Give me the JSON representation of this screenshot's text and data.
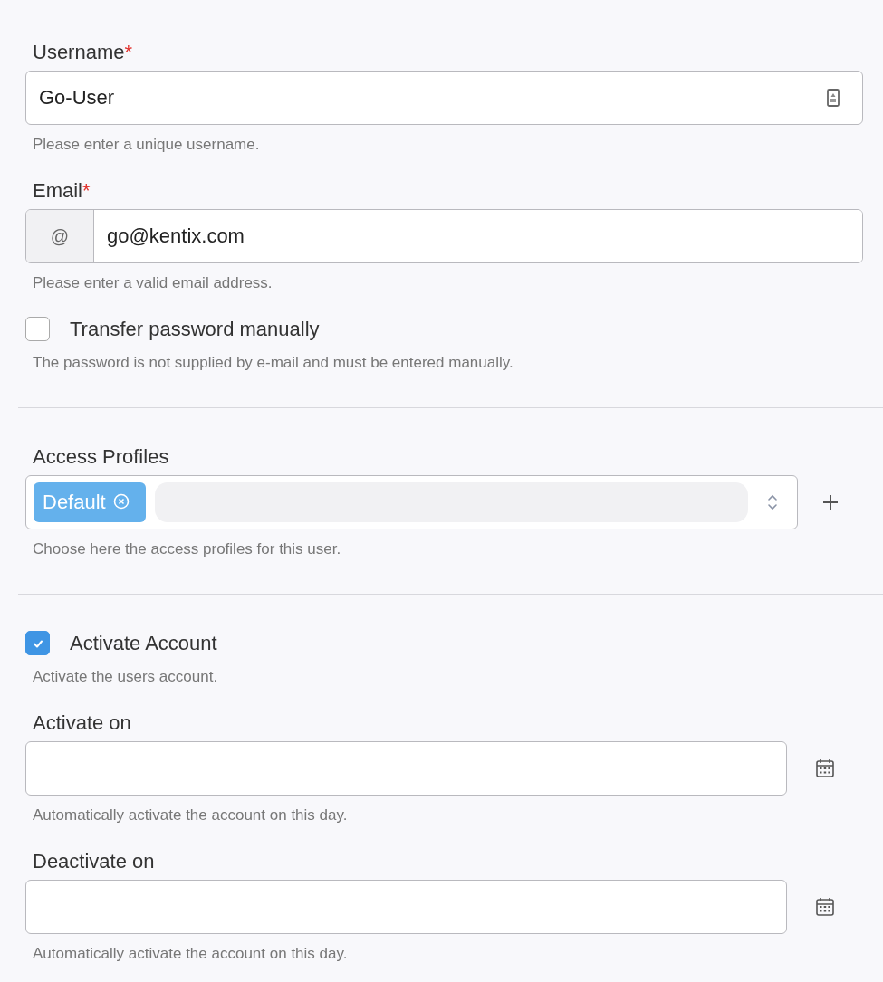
{
  "sections": [
    {
      "items": [
        {
          "kind": "text",
          "label": "Username",
          "required_mark": "*",
          "value": "Go-User",
          "hint": "Please enter a unique username."
        },
        {
          "kind": "prefixed",
          "label": "Email",
          "required_mark": "*",
          "prefix": "@",
          "value": "go@kentix.com",
          "hint": "Please enter a valid email address."
        },
        {
          "kind": "checkbox",
          "label": "Transfer password manually",
          "checked": false,
          "hint": "The password is not supplied by e-mail and must be entered manually."
        }
      ]
    },
    {
      "items": [
        {
          "kind": "tags",
          "label": "Access Profiles",
          "tags": [
            {
              "label": "Default"
            }
          ],
          "hint": "Choose here the access profiles for this user."
        }
      ]
    },
    {
      "items": [
        {
          "kind": "checkbox",
          "label": "Activate Account",
          "checked": true,
          "hint": "Activate the users account."
        },
        {
          "kind": "date",
          "label": "Activate on",
          "hint": "Automatically activate the account on this day."
        },
        {
          "kind": "date",
          "label": "Deactivate on",
          "hint": "Automatically activate the account on this day."
        }
      ]
    }
  ]
}
